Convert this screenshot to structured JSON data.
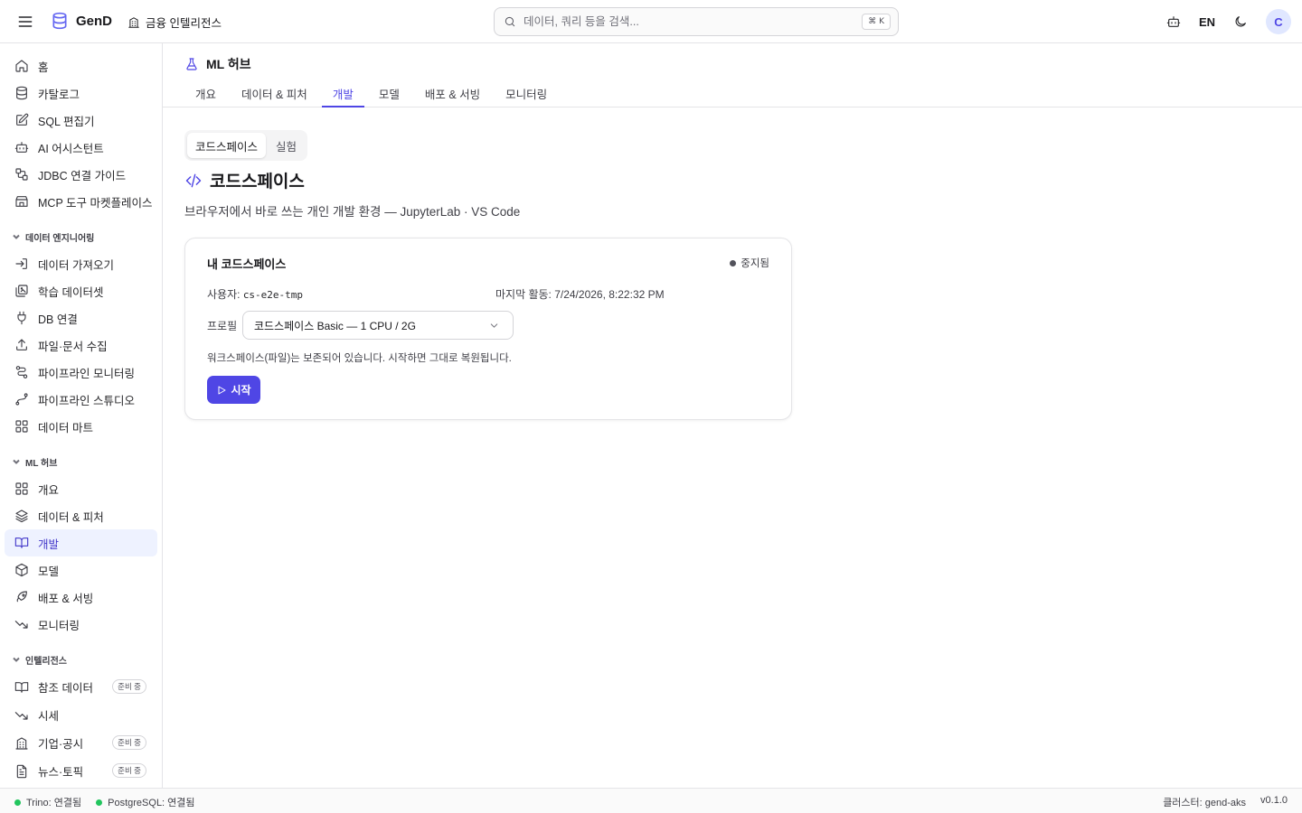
{
  "header": {
    "logo": "GenD",
    "org": "금융 인텔리전스",
    "search_placeholder": "데이터, 쿼리 등을 검색...",
    "shortcut": "⌘ K",
    "lang": "EN",
    "avatar": "C"
  },
  "sidebar": {
    "top_items": [
      {
        "label": "홈",
        "icon": "home-icon"
      },
      {
        "label": "카탈로그",
        "icon": "database-icon"
      },
      {
        "label": "SQL 편집기",
        "icon": "edit-icon"
      },
      {
        "label": "AI 어시스턴트",
        "icon": "bot-icon"
      },
      {
        "label": "JDBC 연결 가이드",
        "icon": "workflow-icon"
      },
      {
        "label": "MCP 도구 마켓플레이스",
        "icon": "store-icon"
      }
    ],
    "sections": [
      {
        "title": "데이터 엔지니어링",
        "items": [
          {
            "label": "데이터 가져오기",
            "icon": "import-icon"
          },
          {
            "label": "학습 데이터셋",
            "icon": "images-icon"
          },
          {
            "label": "DB 연결",
            "icon": "plug-icon"
          },
          {
            "label": "파일·문서 수집",
            "icon": "upload-icon"
          },
          {
            "label": "파이프라인 모니터링",
            "icon": "route-icon"
          },
          {
            "label": "파이프라인 스튜디오",
            "icon": "spline-icon"
          },
          {
            "label": "데이터 마트",
            "icon": "grid-icon"
          }
        ]
      },
      {
        "title": "ML 허브",
        "items": [
          {
            "label": "개요",
            "icon": "grid-icon"
          },
          {
            "label": "데이터 & 피처",
            "icon": "layers-icon"
          },
          {
            "label": "개발",
            "icon": "book-icon"
          },
          {
            "label": "모델",
            "icon": "box-icon"
          },
          {
            "label": "배포 & 서빙",
            "icon": "rocket-icon"
          },
          {
            "label": "모니터링",
            "icon": "trending-down-icon"
          }
        ]
      },
      {
        "title": "인텔리전스",
        "items": [
          {
            "label": "참조 데이터",
            "icon": "book-icon",
            "badge": "준비 중"
          },
          {
            "label": "시세",
            "icon": "trending-down-icon"
          },
          {
            "label": "기업·공시",
            "icon": "building-icon",
            "badge": "준비 중"
          },
          {
            "label": "뉴스·토픽",
            "icon": "file-icon",
            "badge": "준비 중"
          }
        ]
      }
    ]
  },
  "page": {
    "title": "ML 허브",
    "tabs": [
      "개요",
      "데이터 & 피처",
      "개발",
      "모델",
      "배포 & 서빙",
      "모니터링"
    ],
    "active_tab": "개발",
    "segments": [
      "코드스페이스",
      "실험"
    ],
    "heading": "코드스페이스",
    "subtitle": "브라우저에서 바로 쓰는 개인 개발 환경 — JupyterLab · VS Code"
  },
  "card": {
    "title": "내 코드스페이스",
    "status": "중지됨",
    "user_label": "사용자:",
    "user_value": "cs-e2e-tmp",
    "last_activity": "마지막 활동: 7/24/2026, 8:22:32 PM",
    "profile_label": "프로필",
    "profile_value": "코드스페이스 Basic — 1 CPU / 2G",
    "note": "워크스페이스(파일)는 보존되어 있습니다. 시작하면 그대로 복원됩니다.",
    "start_label": "시작"
  },
  "footer": {
    "trino": "Trino: 연결됨",
    "postgres": "PostgreSQL: 연결됨",
    "cluster": "클러스터: gend-aks",
    "version": "v0.1.0"
  },
  "colors": {
    "accent": "#4f46e5",
    "active_bg": "#eef2ff",
    "status_ok": "#22c55e"
  }
}
